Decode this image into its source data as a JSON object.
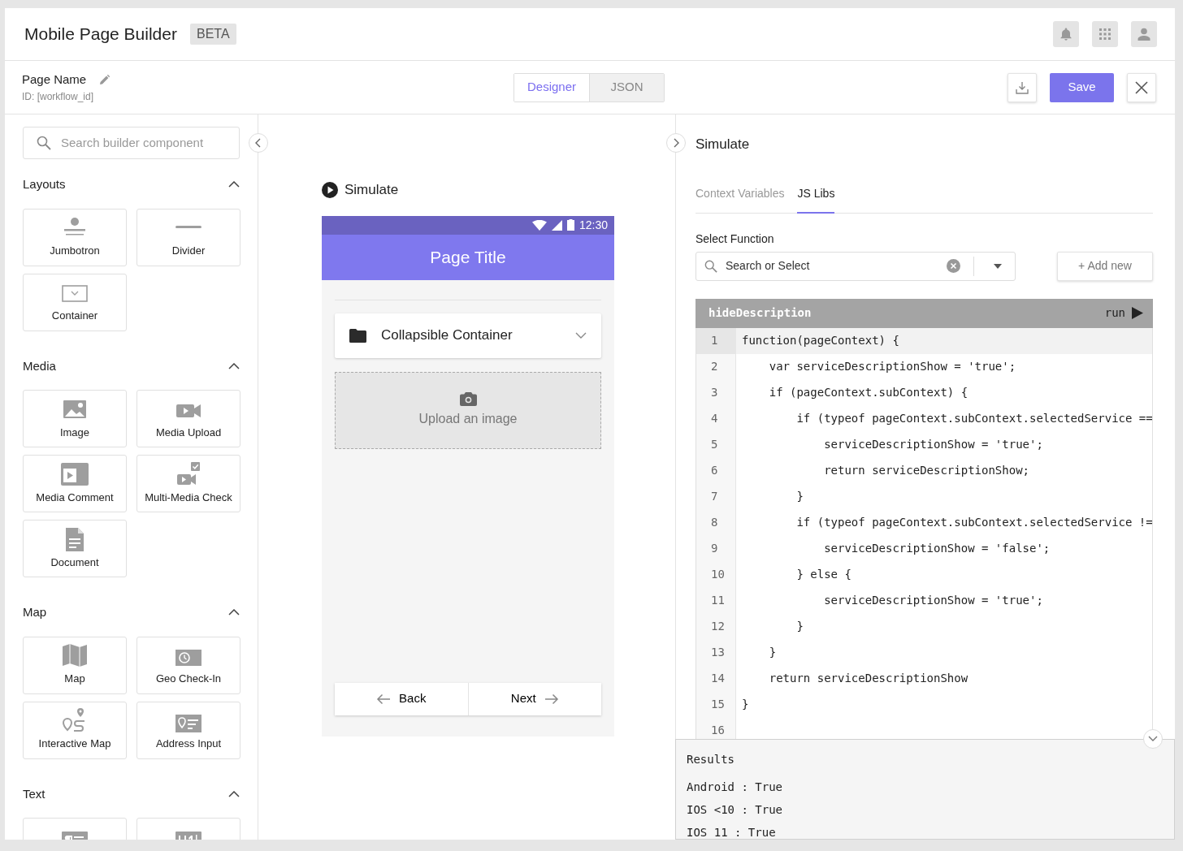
{
  "app": {
    "title": "Mobile Page Builder",
    "badge": "BETA"
  },
  "page": {
    "name": "Page Name",
    "id": "ID: [workflow_id]"
  },
  "view_tabs": [
    {
      "label": "Designer",
      "selected": true
    },
    {
      "label": "JSON",
      "selected": false
    }
  ],
  "save_button": "Save",
  "sidebar": {
    "search": {
      "placeholder": "Search builder component"
    },
    "sections": [
      {
        "title": "Layouts",
        "expanded": true,
        "items": [
          {
            "label": "Jumbotron",
            "kind": "jumbotron"
          },
          {
            "label": "Divider",
            "kind": "divider"
          },
          {
            "label": "Container",
            "kind": "container"
          }
        ]
      },
      {
        "title": "Media",
        "expanded": true,
        "items": [
          {
            "label": "Image",
            "kind": "image"
          },
          {
            "label": "Media Upload",
            "kind": "video"
          },
          {
            "label": "Media Comment",
            "kind": "video-comment"
          },
          {
            "label": "Multi-Media Check",
            "kind": "video-check"
          },
          {
            "label": "Document",
            "kind": "document"
          }
        ]
      },
      {
        "title": "Map",
        "expanded": true,
        "items": [
          {
            "label": "Map",
            "kind": "map"
          },
          {
            "label": "Geo Check-In",
            "kind": "clock"
          },
          {
            "label": "Interactive Map",
            "kind": "route"
          },
          {
            "label": "Address Input",
            "kind": "address"
          }
        ]
      },
      {
        "title": "Text",
        "expanded": true,
        "items": [
          {
            "kind": "paragraph"
          },
          {
            "kind": "heading"
          }
        ]
      }
    ]
  },
  "preview": {
    "title": "Simulate",
    "status_time": "12:30",
    "page_title": "Page Title",
    "collapsible": "Collapsible Container",
    "upload": "Upload an image",
    "back": "Back",
    "next": "Next"
  },
  "panel": {
    "title": "Simulate",
    "tabs": [
      {
        "label": "Context Variables",
        "selected": false
      },
      {
        "label": "JS Libs",
        "selected": true
      }
    ],
    "select_label": "Select Function",
    "select": {
      "placeholder": "Search or Select"
    },
    "add_button": "+ Add new",
    "editor": {
      "function_name": "hideDescription",
      "run": "run",
      "lines": [
        {
          "number": "1",
          "code": "function(pageContext) {",
          "selected": true
        },
        {
          "number": "2",
          "code": "    var serviceDescriptionShow = 'true';",
          "selected": false
        },
        {
          "number": "3",
          "code": "    if (pageContext.subContext) {",
          "selected": false
        },
        {
          "number": "4",
          "code": "        if (typeof pageContext.subContext.selectedService ==",
          "selected": false
        },
        {
          "number": "5",
          "code": "            serviceDescriptionShow = 'true';",
          "selected": false
        },
        {
          "number": "6",
          "code": "            return serviceDescriptionShow;",
          "selected": false
        },
        {
          "number": "7",
          "code": "        }",
          "selected": false
        },
        {
          "number": "8",
          "code": "        if (typeof pageContext.subContext.selectedService !=",
          "selected": false
        },
        {
          "number": "9",
          "code": "            serviceDescriptionShow = 'false';",
          "selected": false
        },
        {
          "number": "10",
          "code": "        } else {",
          "selected": false
        },
        {
          "number": "11",
          "code": "            serviceDescriptionShow = 'true';",
          "selected": false
        },
        {
          "number": "12",
          "code": "        }",
          "selected": false
        },
        {
          "number": "13",
          "code": "    }",
          "selected": false
        },
        {
          "number": "14",
          "code": "    return serviceDescriptionShow",
          "selected": false
        },
        {
          "number": "15",
          "code": "}",
          "selected": false
        },
        {
          "number": "16",
          "selected": false
        }
      ]
    },
    "results": {
      "title": "Results",
      "lines": [
        "Android : True",
        "IOS <10 : True",
        "IOS 11 : True"
      ]
    }
  }
}
